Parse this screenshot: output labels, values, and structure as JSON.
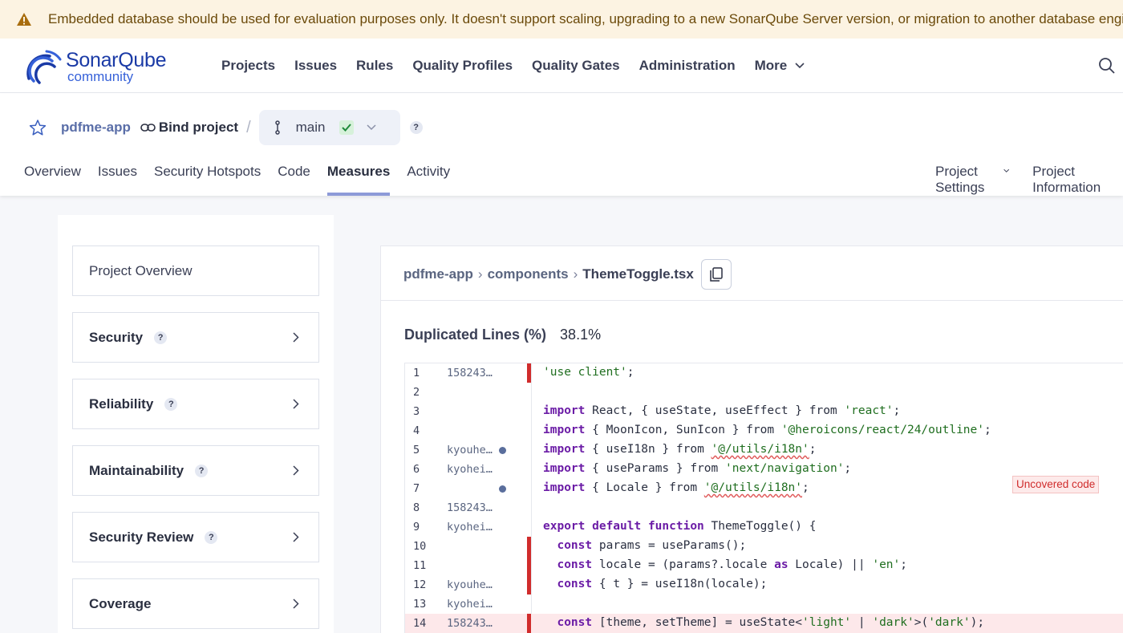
{
  "banner": {
    "message": "Embedded database should be used for evaluation purposes only. It doesn't support scaling, upgrading to a new SonarQube Server version, or migration to another database engine.",
    "color": "#fcf3e2"
  },
  "nav": {
    "logo_name": "SonarQube",
    "logo_edition": "community",
    "items": [
      "Projects",
      "Issues",
      "Rules",
      "Quality Profiles",
      "Quality Gates",
      "Administration",
      "More"
    ]
  },
  "project": {
    "name": "pdfme-app",
    "bind_label": "Bind project",
    "branch": "main",
    "help": "?"
  },
  "tabs": [
    "Overview",
    "Issues",
    "Security Hotspots",
    "Code",
    "Measures",
    "Activity"
  ],
  "active_tab": "Measures",
  "right_tabs": [
    "Project Settings",
    "Project Information"
  ],
  "sidebar": {
    "items": [
      {
        "label": "Project Overview",
        "help": "",
        "arrow": false
      },
      {
        "label": "Security",
        "help": "?",
        "arrow": true
      },
      {
        "label": "Reliability",
        "help": "?",
        "arrow": true
      },
      {
        "label": "Maintainability",
        "help": "?",
        "arrow": true
      },
      {
        "label": "Security Review",
        "help": "?",
        "arrow": true
      },
      {
        "label": "Coverage",
        "help": "",
        "arrow": true
      }
    ]
  },
  "file": {
    "path": [
      "pdfme-app",
      "components",
      "ThemeToggle.tsx"
    ],
    "measure_label": "Duplicated Lines (%)",
    "measure_value": "38.1%"
  },
  "code_lines": [
    {
      "n": "1",
      "author": "158243…",
      "dot": false,
      "dup": true,
      "uncovered": false,
      "tokens": [
        {
          "t": "'use client'",
          "c": "str"
        },
        {
          "t": ";"
        }
      ]
    },
    {
      "n": "2",
      "author": "",
      "dot": false,
      "dup": false,
      "uncovered": false,
      "tokens": []
    },
    {
      "n": "3",
      "author": "",
      "dot": false,
      "dup": false,
      "uncovered": false,
      "tokens": [
        {
          "t": "import",
          "c": "kw"
        },
        {
          "t": " React, { useState, useEffect } from "
        },
        {
          "t": "'react'",
          "c": "str"
        },
        {
          "t": ";"
        }
      ]
    },
    {
      "n": "4",
      "author": "",
      "dot": false,
      "dup": false,
      "uncovered": false,
      "tokens": [
        {
          "t": "import",
          "c": "kw"
        },
        {
          "t": " { MoonIcon, SunIcon } from "
        },
        {
          "t": "'@heroicons/react/24/outline'",
          "c": "str"
        },
        {
          "t": ";"
        }
      ]
    },
    {
      "n": "5",
      "author": "kyouhe…",
      "dot": true,
      "dup": false,
      "uncovered": false,
      "tokens": [
        {
          "t": "import",
          "c": "kw"
        },
        {
          "t": " { useI18n } from "
        },
        {
          "t": "'@/utils/i18n'",
          "c": "str err"
        },
        {
          "t": ";"
        }
      ]
    },
    {
      "n": "6",
      "author": "kyohei…",
      "dot": false,
      "dup": false,
      "uncovered": false,
      "tokens": [
        {
          "t": "import",
          "c": "kw"
        },
        {
          "t": " { useParams } from "
        },
        {
          "t": "'next/navigation'",
          "c": "str"
        },
        {
          "t": ";"
        }
      ]
    },
    {
      "n": "7",
      "author": "",
      "dot": true,
      "dup": false,
      "uncovered": false,
      "tokens": [
        {
          "t": "import",
          "c": "kw"
        },
        {
          "t": " { Locale } from "
        },
        {
          "t": "'@/utils/i18n'",
          "c": "str err"
        },
        {
          "t": ";"
        }
      ]
    },
    {
      "n": "8",
      "author": "158243…",
      "dot": false,
      "dup": false,
      "uncovered": false,
      "tokens": []
    },
    {
      "n": "9",
      "author": "kyohei…",
      "dot": false,
      "dup": false,
      "uncovered": false,
      "tokens": [
        {
          "t": "export default function",
          "c": "kw"
        },
        {
          "t": " ThemeToggle() {"
        }
      ]
    },
    {
      "n": "10",
      "author": "",
      "dot": false,
      "dup": true,
      "uncovered": false,
      "tokens": [
        {
          "t": "  "
        },
        {
          "t": "const",
          "c": "kw"
        },
        {
          "t": " params = useParams();"
        }
      ]
    },
    {
      "n": "11",
      "author": "",
      "dot": false,
      "dup": true,
      "uncovered": false,
      "tokens": [
        {
          "t": "  "
        },
        {
          "t": "const",
          "c": "kw"
        },
        {
          "t": " locale = (params?.locale "
        },
        {
          "t": "as",
          "c": "kw"
        },
        {
          "t": " Locale) || "
        },
        {
          "t": "'en'",
          "c": "str"
        },
        {
          "t": ";"
        }
      ]
    },
    {
      "n": "12",
      "author": "kyouhe…",
      "dot": false,
      "dup": true,
      "uncovered": false,
      "tokens": [
        {
          "t": "  "
        },
        {
          "t": "const",
          "c": "kw"
        },
        {
          "t": " { t } = useI18n(locale);"
        }
      ]
    },
    {
      "n": "13",
      "author": "kyohei…",
      "dot": false,
      "dup": false,
      "uncovered": false,
      "tokens": []
    },
    {
      "n": "14",
      "author": "158243…",
      "dot": false,
      "dup": true,
      "uncovered": true,
      "tokens": [
        {
          "t": "  "
        },
        {
          "t": "const",
          "c": "kw"
        },
        {
          "t": " [theme, setTheme] = useState<"
        },
        {
          "t": "'light'",
          "c": "str"
        },
        {
          "t": " | "
        },
        {
          "t": "'dark'",
          "c": "str"
        },
        {
          "t": ">("
        },
        {
          "t": "'dark'",
          "c": "str"
        },
        {
          "t": ");"
        }
      ]
    }
  ],
  "tooltip": "Uncovered code",
  "colors": {
    "accent": "#8d9ad8",
    "duplication_marker": "#d02c2c",
    "uncovered_bg": "#fde8ea",
    "brand": "#1a3aa6"
  },
  "icons": {
    "banner": "warning-icon",
    "star": "star-icon",
    "bind": "link-icon",
    "branch": "branch-icon",
    "search": "search-icon",
    "copy": "copy-icon"
  }
}
